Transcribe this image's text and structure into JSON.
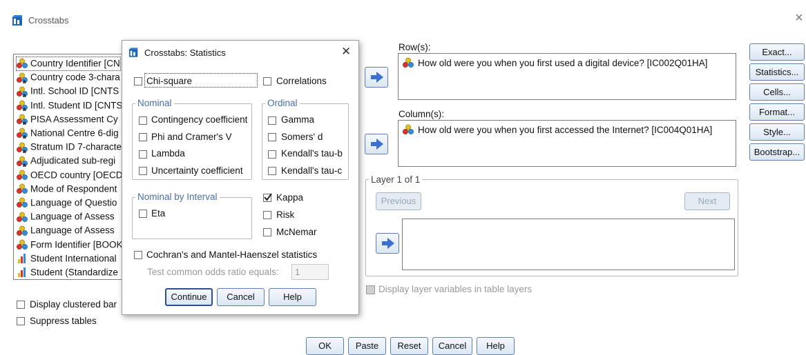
{
  "main": {
    "title": "Crosstabs",
    "close_glyph": "×",
    "variables": [
      {
        "label": "Country Identifier [CN",
        "icon": "nominal-icon",
        "selected": true
      },
      {
        "label": "Country code 3-chara",
        "icon": "nominal-string-icon"
      },
      {
        "label": "Intl. School ID [CNTS",
        "icon": "nominal-string-icon"
      },
      {
        "label": "Intl. Student ID [CNTS",
        "icon": "nominal-string-icon"
      },
      {
        "label": "PISA Assessment Cy",
        "icon": "nominal-string-icon"
      },
      {
        "label": "National Centre 6-dig",
        "icon": "nominal-string-icon"
      },
      {
        "label": "Stratum ID 7-characte",
        "icon": "nominal-string-icon"
      },
      {
        "label": "Adjudicated sub-regi",
        "icon": "nominal-string-icon"
      },
      {
        "label": "OECD country [OECD",
        "icon": "nominal-icon"
      },
      {
        "label": "Mode of Respondent",
        "icon": "nominal-icon"
      },
      {
        "label": "Language of Questio",
        "icon": "nominal-icon"
      },
      {
        "label": "Language of Assess",
        "icon": "nominal-icon"
      },
      {
        "label": "Language of Assess",
        "icon": "nominal-icon"
      },
      {
        "label": "Form Identifier [BOOK",
        "icon": "nominal-icon"
      },
      {
        "label": "Student International",
        "icon": "scale-icon"
      },
      {
        "label": "Student (Standardize",
        "icon": "scale-icon"
      }
    ],
    "rows_label": "Row(s):",
    "row_item": "How old were you when you first used a digital device? [IC002Q01HA]",
    "columns_label": "Column(s):",
    "column_item": "How old were you when you first accessed the Internet? [IC004Q01HA]",
    "layer_legend": "Layer 1 of 1",
    "previous": "Previous",
    "next": "Next",
    "display_layer": "Display layer variables in table layers",
    "display_clustered": "Display clustered bar",
    "suppress": "Suppress tables",
    "side_buttons": [
      "Exact...",
      "Statistics...",
      "Cells...",
      "Format...",
      "Style...",
      "Bootstrap..."
    ],
    "bottom_buttons": [
      "OK",
      "Paste",
      "Reset",
      "Cancel",
      "Help"
    ]
  },
  "stats": {
    "title": "Crosstabs: Statistics",
    "close_glyph": "✕",
    "chi_square": "Chi-square",
    "correlations": "Correlations",
    "nominal_legend": "Nominal",
    "nominal_items": [
      "Contingency coefficient",
      "Phi and Cramer's V",
      "Lambda",
      "Uncertainty coefficient"
    ],
    "ordinal_legend": "Ordinal",
    "ordinal_items": [
      "Gamma",
      "Somers' d",
      "Kendall's tau-b",
      "Kendall's tau-c"
    ],
    "nbi_legend": "Nominal by Interval",
    "eta": "Eta",
    "kappa": "Kappa",
    "kappa_checked": true,
    "risk": "Risk",
    "mcnemar": "McNemar",
    "cochrans": "Cochran's and Mantel-Haenszel statistics",
    "odds_label": "Test common odds ratio equals:",
    "odds_value": "1",
    "buttons": {
      "continue": "Continue",
      "cancel": "Cancel",
      "help": "Help"
    }
  },
  "colors": {
    "accent": "#4a6fa5",
    "button_border": "#5c7fae",
    "arrow": "#3b6fd4"
  }
}
